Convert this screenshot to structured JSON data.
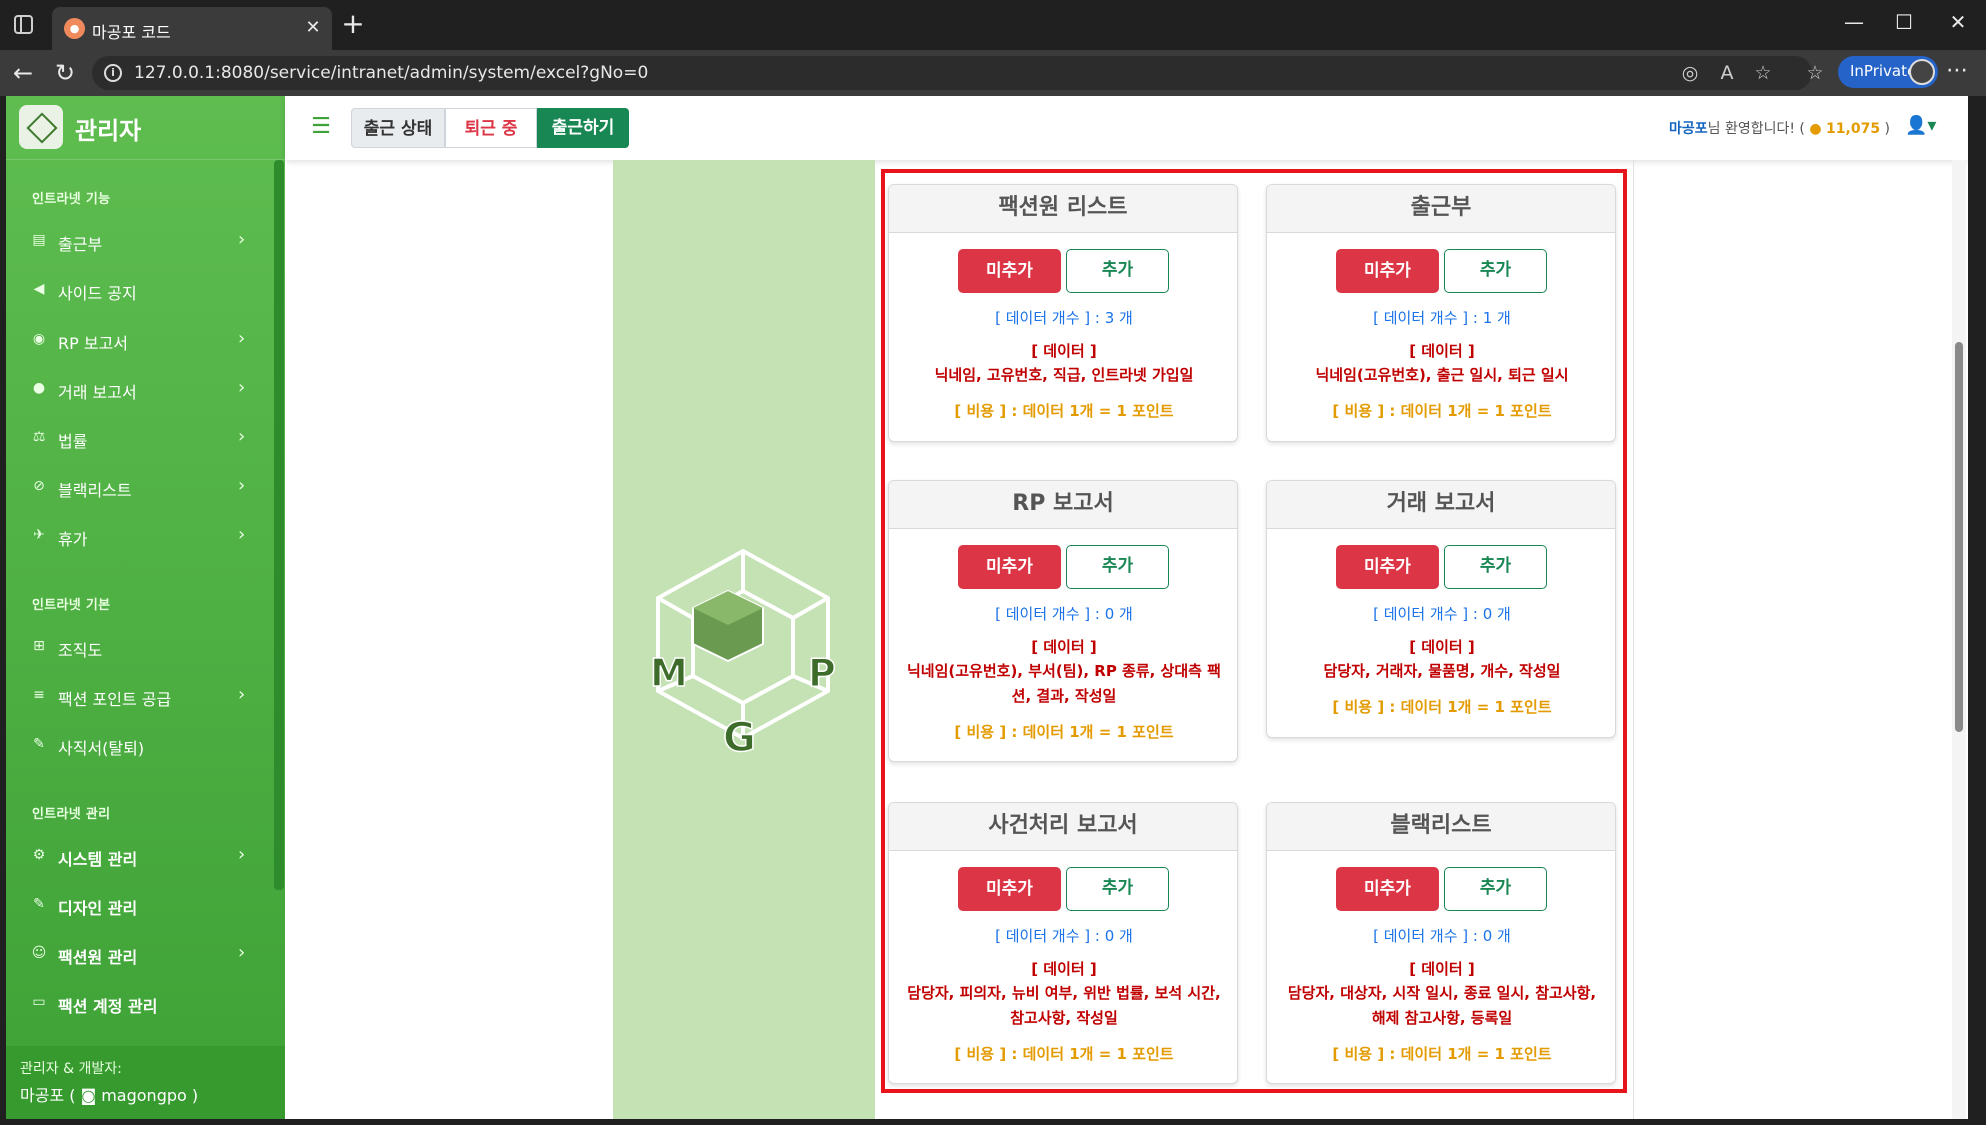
{
  "browser": {
    "tab_title": "마공포 코드",
    "url": "127.0.0.1:8080/service/intranet/admin/system/excel?gNo=0",
    "inprivate_label": "InPrivate"
  },
  "sidebar": {
    "brand": "관리자",
    "sections": [
      {
        "heading": "인트라넷 기능"
      },
      {
        "heading": "인트라넷 기본"
      },
      {
        "heading": "인트라넷 관리"
      }
    ],
    "items": [
      {
        "label": "출근부",
        "icon": "book-icon",
        "has_submenu": true
      },
      {
        "label": "사이드 공지",
        "icon": "megaphone-icon",
        "has_submenu": false
      },
      {
        "label": "RP 보고서",
        "icon": "gamepad-icon",
        "has_submenu": true
      },
      {
        "label": "거래 보고서",
        "icon": "money-bag-icon",
        "has_submenu": true
      },
      {
        "label": "법률",
        "icon": "scale-icon",
        "has_submenu": true
      },
      {
        "label": "블랙리스트",
        "icon": "ban-icon",
        "has_submenu": true
      },
      {
        "label": "휴가",
        "icon": "plane-icon",
        "has_submenu": true
      },
      {
        "label": "조직도",
        "icon": "sitemap-icon",
        "has_submenu": false
      },
      {
        "label": "팩션 포인트 공급",
        "icon": "coins-icon",
        "has_submenu": true
      },
      {
        "label": "사직서(탈퇴)",
        "icon": "pen-icon",
        "has_submenu": false
      },
      {
        "label": "시스템 관리",
        "icon": "gear-icon",
        "has_submenu": true
      },
      {
        "label": "디자인 관리",
        "icon": "brush-icon",
        "has_submenu": false
      },
      {
        "label": "팩션원 관리",
        "icon": "user-gear-icon",
        "has_submenu": true
      },
      {
        "label": "팩션 계정 관리",
        "icon": "id-card-icon",
        "has_submenu": false
      }
    ],
    "footer": {
      "line1": "관리자 & 개발자:",
      "line2_name": "마공포 (",
      "line2_discord": "magongpo )"
    }
  },
  "topbar": {
    "status_label": "출근 상태",
    "off_label": "퇴근 중",
    "checkin_label": "출근하기",
    "welcome_name": "마공포",
    "welcome_text": "님 환영합니다! (",
    "points": "11,075",
    "welcome_close": ")"
  },
  "cards": [
    {
      "title": "팩션원 리스트",
      "unadd_label": "미추가",
      "add_label": "추가",
      "count_text": "[ 데이터 개수 ] : 3 개",
      "data_heading": "[ 데이터 ]",
      "data_fields": "닉네임, 고유번호, 직급, 인트라넷 가입일",
      "cost_text": "[ 비용 ] : 데이터 1개 = 1 포인트"
    },
    {
      "title": "출근부",
      "unadd_label": "미추가",
      "add_label": "추가",
      "count_text": "[ 데이터 개수 ] : 1 개",
      "data_heading": "[ 데이터 ]",
      "data_fields": "닉네임(고유번호), 출근 일시, 퇴근 일시",
      "cost_text": "[ 비용 ] : 데이터 1개 = 1 포인트"
    },
    {
      "title": "RP 보고서",
      "unadd_label": "미추가",
      "add_label": "추가",
      "count_text": "[ 데이터 개수 ] : 0 개",
      "data_heading": "[ 데이터 ]",
      "data_fields": "닉네임(고유번호), 부서(팀), RP 종류, 상대측 팩션, 결과, 작성일",
      "cost_text": "[ 비용 ] : 데이터 1개 = 1 포인트"
    },
    {
      "title": "거래 보고서",
      "unadd_label": "미추가",
      "add_label": "추가",
      "count_text": "[ 데이터 개수 ] : 0 개",
      "data_heading": "[ 데이터 ]",
      "data_fields": "담당자, 거래자, 물품명, 개수, 작성일",
      "cost_text": "[ 비용 ] : 데이터 1개 = 1 포인트"
    },
    {
      "title": "사건처리 보고서",
      "unadd_label": "미추가",
      "add_label": "추가",
      "count_text": "[ 데이터 개수 ] : 0 개",
      "data_heading": "[ 데이터 ]",
      "data_fields": "담당자, 피의자, 뉴비 여부, 위반 법률, 보석 시간, 참고사항, 작성일",
      "cost_text": "[ 비용 ] : 데이터 1개 = 1 포인트"
    },
    {
      "title": "블랙리스트",
      "unadd_label": "미추가",
      "add_label": "추가",
      "count_text": "[ 데이터 개수 ] : 0 개",
      "data_heading": "[ 데이터 ]",
      "data_fields": "담당자, 대상자, 시작 일시, 종료 일시, 참고사항, 해제 참고사항, 등록일",
      "cost_text": "[ 비용 ] : 데이터 1개 = 1 포인트"
    }
  ],
  "logo_letters": [
    "M",
    "G",
    "P"
  ],
  "colors": {
    "sidebar_green": "#4cae3f",
    "danger": "#dc3545",
    "success": "#198754",
    "highlight": "#e8141b",
    "info_blue": "#1a73e8",
    "cost_orange": "#e39b00"
  }
}
